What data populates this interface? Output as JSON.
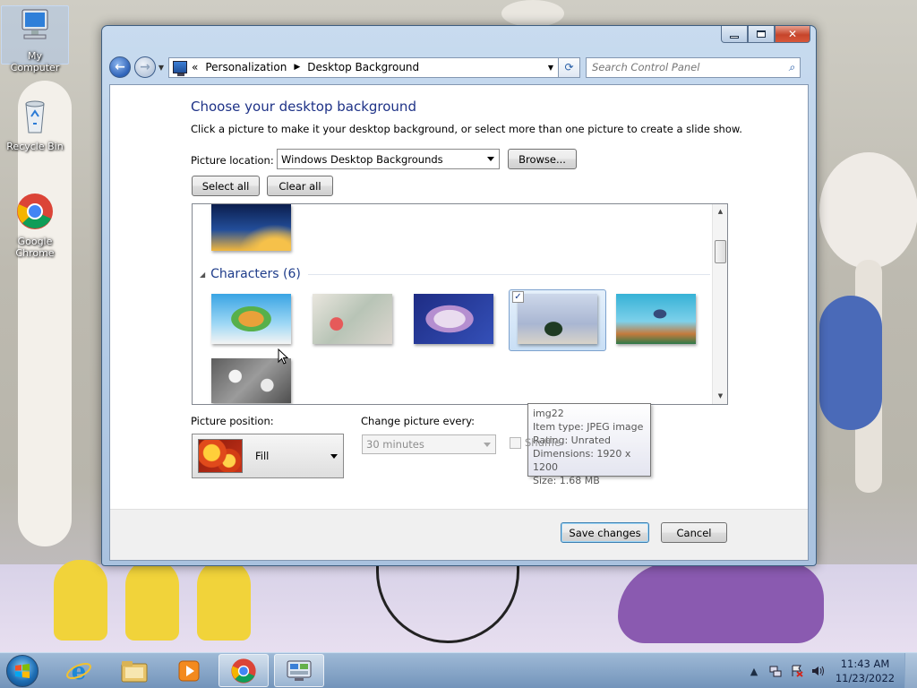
{
  "desktop": {
    "icons": [
      {
        "label": "My Computer"
      },
      {
        "label": "Recycle Bin"
      },
      {
        "label": "Google Chrome"
      }
    ]
  },
  "window": {
    "controls": {
      "close_glyph": "✕"
    },
    "nav": {
      "back_glyph": "←",
      "forward_glyph": "→",
      "breadcrumb": [
        "Personalization",
        "Desktop Background"
      ],
      "breadcrumb_prefix": "«",
      "search_placeholder": "Search Control Panel"
    },
    "content": {
      "title": "Choose your desktop background",
      "description": "Click a picture to make it your desktop background, or select more than one picture to create a slide show.",
      "picture_location_label": "Picture location:",
      "picture_location_value": "Windows Desktop Backgrounds",
      "browse_label": "Browse...",
      "select_all_label": "Select all",
      "clear_all_label": "Clear all",
      "group_title": "Characters (6)",
      "selected_checkmark": "✓",
      "tooltip": {
        "name": "img22",
        "type": "Item type: JPEG image",
        "rating": "Rating: Unrated",
        "dimensions": "Dimensions: 1920 x 1200",
        "size": "Size: 1.68 MB"
      },
      "picture_position_label": "Picture position:",
      "picture_position_value": "Fill",
      "change_every_label": "Change picture every:",
      "change_every_value": "30 minutes",
      "shuffle_label": "Shuffle",
      "save_label": "Save changes",
      "cancel_label": "Cancel"
    }
  },
  "taskbar": {
    "clock_time": "11:43 AM",
    "clock_date": "11/23/2022"
  },
  "colors": {
    "title_blue": "#1e3287",
    "group_blue": "#1e3c8a",
    "taskbar": "#7b9fc6"
  }
}
